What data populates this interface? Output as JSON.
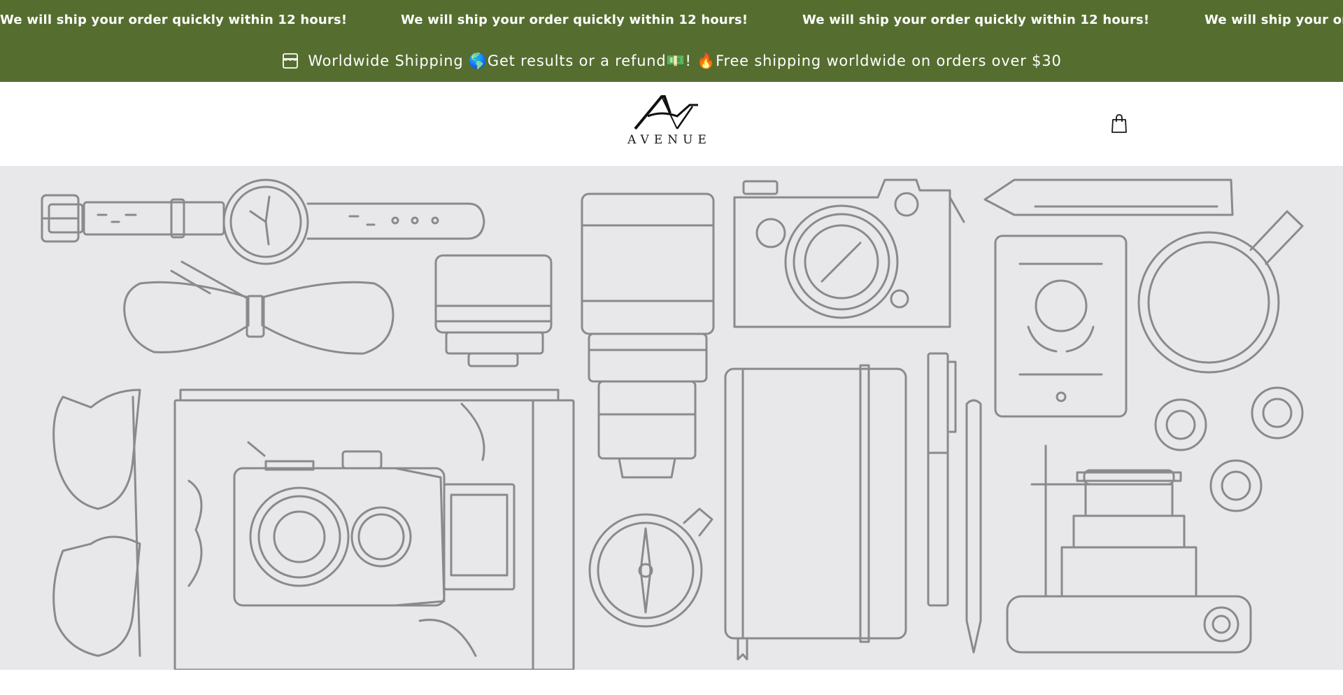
{
  "marquee": {
    "message": "We will ship your order quickly within 12 hours!"
  },
  "announcement": {
    "text": "Worldwide Shipping 🌎Get results or a refund💵! 🔥Free shipping worldwide on orders over $30",
    "icon": "store-icon"
  },
  "header": {
    "logo_text": "AVENUE",
    "cart_icon": "shopping-bag-icon"
  },
  "colors": {
    "announcement_bg": "#566d30",
    "announcement_text": "#ffffff",
    "hero_bg": "#e8e8ea",
    "line_art": "#8a8a8e"
  }
}
